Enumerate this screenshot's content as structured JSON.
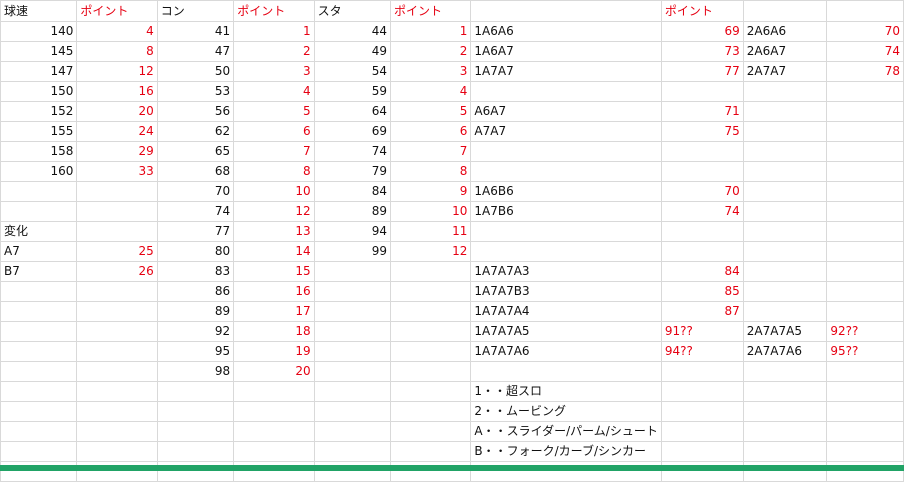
{
  "sheet": {
    "colors": {
      "point_text": "#e60012",
      "grid": "#d9d9d9",
      "status_bar": "#21a366"
    },
    "headers": [
      "球速",
      "ポイント",
      "コン",
      "ポイント",
      "スタ",
      "ポイント",
      "",
      "ポイント",
      "",
      ""
    ],
    "rows": [
      [
        "140",
        "4",
        "41",
        "1",
        "44",
        "1",
        "1A6A6",
        "69",
        "2A6A6",
        "70"
      ],
      [
        "145",
        "8",
        "47",
        "2",
        "49",
        "2",
        "1A6A7",
        "73",
        "2A6A7",
        "74"
      ],
      [
        "147",
        "12",
        "50",
        "3",
        "54",
        "3",
        "1A7A7",
        "77",
        "2A7A7",
        "78"
      ],
      [
        "150",
        "16",
        "53",
        "4",
        "59",
        "4",
        "",
        "",
        "",
        ""
      ],
      [
        "152",
        "20",
        "56",
        "5",
        "64",
        "5",
        "A6A7",
        "71",
        "",
        ""
      ],
      [
        "155",
        "24",
        "62",
        "6",
        "69",
        "6",
        "A7A7",
        "75",
        "",
        ""
      ],
      [
        "158",
        "29",
        "65",
        "7",
        "74",
        "7",
        "",
        "",
        "",
        ""
      ],
      [
        "160",
        "33",
        "68",
        "8",
        "79",
        "8",
        "",
        "",
        "",
        ""
      ],
      [
        "",
        "",
        "70",
        "10",
        "84",
        "9",
        "1A6B6",
        "70",
        "",
        ""
      ],
      [
        "",
        "",
        "74",
        "12",
        "89",
        "10",
        "1A7B6",
        "74",
        "",
        ""
      ],
      [
        "変化",
        "",
        "77",
        "13",
        "94",
        "11",
        "",
        "",
        "",
        ""
      ],
      [
        "A7",
        "25",
        "80",
        "14",
        "99",
        "12",
        "",
        "",
        "",
        ""
      ],
      [
        "B7",
        "26",
        "83",
        "15",
        "",
        "",
        "1A7A7A3",
        "84",
        "",
        ""
      ],
      [
        "",
        "",
        "86",
        "16",
        "",
        "",
        "1A7A7B3",
        "85",
        "",
        ""
      ],
      [
        "",
        "",
        "89",
        "17",
        "",
        "",
        "1A7A7A4",
        "87",
        "",
        ""
      ],
      [
        "",
        "",
        "92",
        "18",
        "",
        "",
        "1A7A7A5",
        "91??",
        "2A7A7A5",
        "92??"
      ],
      [
        "",
        "",
        "95",
        "19",
        "",
        "",
        "1A7A7A6",
        "94??",
        "2A7A7A6",
        "95??"
      ],
      [
        "",
        "",
        "98",
        "20",
        "",
        "",
        "",
        "",
        "",
        ""
      ],
      [
        "",
        "",
        "",
        "",
        "",
        "",
        "1・・超スロ",
        "",
        "",
        ""
      ],
      [
        "",
        "",
        "",
        "",
        "",
        "",
        "2・・ムービング",
        "",
        "",
        ""
      ],
      [
        "",
        "",
        "",
        "",
        "",
        "",
        "A・・スライダー/パーム/シュート",
        "",
        "",
        ""
      ],
      [
        "",
        "",
        "",
        "",
        "",
        "",
        "B・・フォーク/カーブ/シンカー",
        "",
        "",
        ""
      ],
      [
        "",
        "",
        "",
        "",
        "",
        "",
        "",
        "",
        "",
        ""
      ]
    ]
  }
}
